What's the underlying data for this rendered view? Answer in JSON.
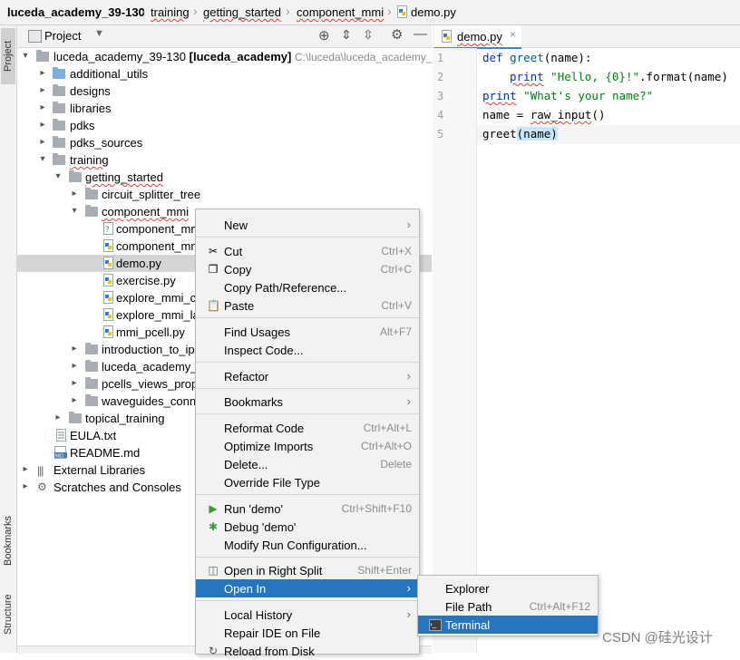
{
  "navbar": {
    "project": "luceda_academy_39-130",
    "crumbs": [
      "training",
      "getting_started",
      "component_mmi",
      "demo.py"
    ]
  },
  "stripe": {
    "project_tab": "Project",
    "bookmarks_tab": "Bookmarks",
    "structure_tab": "Structure"
  },
  "project_panel": {
    "title": "Project",
    "root_name": "luceda_academy_39-130",
    "root_module": "[luceda_academy]",
    "root_path": "C:\\luceda\\luceda_academy_39",
    "items": {
      "additional_utils": "additional_utils",
      "designs": "designs",
      "libraries": "libraries",
      "pdks": "pdks",
      "pdks_sources": "pdks_sources",
      "training": "training",
      "getting_started": "getting_started",
      "circuit_splitter_tree": "circuit_splitter_tree",
      "component_mmi": "component_mmi",
      "file1": "component_mm",
      "file2": "component_mm",
      "demo": "demo.py",
      "exercise": "exercise.py",
      "explore1": "explore_mmi_ci",
      "explore2": "explore_mmi_la",
      "mmi_pcell": "mmi_pcell.py",
      "introduction": "introduction_to_ip",
      "luceda_academy": "luceda_academy_a",
      "pcells": "pcells_views_prope",
      "waveguides": "waveguides_conne",
      "topical_training": "topical_training",
      "eula": "EULA.txt",
      "readme": "README.md",
      "external_libraries": "External Libraries",
      "scratches": "Scratches and Consoles"
    }
  },
  "editor": {
    "tab": "demo.py",
    "line_numbers": [
      "1",
      "2",
      "3",
      "4",
      "5"
    ],
    "lines": {
      "l1_kw": "def",
      "l1_fn": "greet",
      "l1_rest": "(name):",
      "l2_kw": "print",
      "l2_str": "\"Hello, {0}!\"",
      "l2_rest": ".format(name)",
      "l3_kw": "print",
      "l3_str": "\"What's your name?\"",
      "l4_a": "name = ",
      "l4_b": "raw_input",
      "l4_c": "()",
      "l5_a": "greet",
      "l5_b": "(name)"
    }
  },
  "context_menu": {
    "new": "New",
    "cut": "Cut",
    "cut_key": "Ctrl+X",
    "copy": "Copy",
    "copy_key": "Ctrl+C",
    "copy_path": "Copy Path/Reference...",
    "paste": "Paste",
    "paste_key": "Ctrl+V",
    "find_usages": "Find Usages",
    "find_usages_key": "Alt+F7",
    "inspect_code": "Inspect Code...",
    "refactor": "Refactor",
    "bookmarks": "Bookmarks",
    "reformat": "Reformat Code",
    "reformat_key": "Ctrl+Alt+L",
    "optimize": "Optimize Imports",
    "optimize_key": "Ctrl+Alt+O",
    "delete": "Delete...",
    "delete_key": "Delete",
    "override": "Override File Type",
    "run": "Run 'demo'",
    "run_key": "Ctrl+Shift+F10",
    "debug": "Debug 'demo'",
    "modify_run": "Modify Run Configuration...",
    "open_right": "Open in Right Split",
    "open_right_key": "Shift+Enter",
    "open_in": "Open In",
    "local_history": "Local History",
    "repair": "Repair IDE on File",
    "reload": "Reload from Disk"
  },
  "submenu": {
    "explorer": "Explorer",
    "file_path": "File Path",
    "file_path_key": "Ctrl+Alt+F12",
    "terminal": "Terminal"
  },
  "watermark": "CSDN @硅光设计",
  "colors": {
    "highlight": "#2675bf",
    "keyword": "#0033b3",
    "string": "#067d17",
    "selection_row": "#d5d5d5"
  }
}
